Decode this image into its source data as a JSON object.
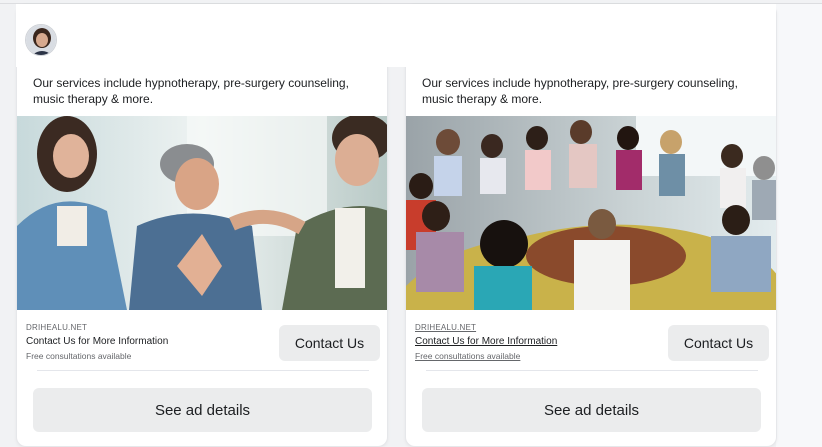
{
  "ads": [
    {
      "body_text": "Our services include hypnotherapy, pre-surgery counseling, music therapy & more.",
      "image_alt": "Young man comforted by two friends",
      "link_domain": "DRIHEALU.NET",
      "link_headline": "Contact Us for More Information",
      "link_description": "Free consultations available",
      "cta_label": "Contact Us",
      "details_label": "See ad details"
    },
    {
      "body_text": "Our services include hypnotherapy, pre-surgery counseling, music therapy & more.",
      "image_alt": "Support group seated in a circle",
      "link_domain": "DRIHEALU.NET",
      "link_headline": "Contact Us for More Information",
      "link_description": "Free consultations available",
      "cta_label": "Contact Us",
      "details_label": "See ad details"
    }
  ],
  "icons": {
    "profile": "profile-avatar-icon"
  },
  "colors": {
    "card_bg": "#ffffff",
    "button_bg": "#ebeced",
    "muted_text": "#65676b",
    "primary_text": "#1c1e21"
  }
}
